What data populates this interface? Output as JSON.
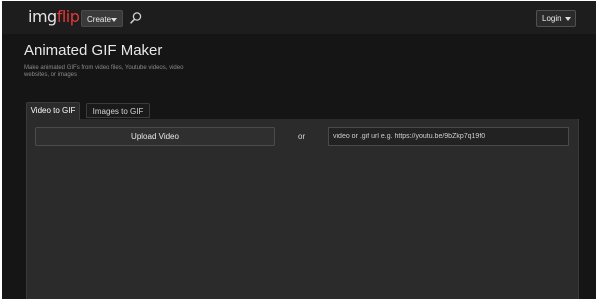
{
  "header": {
    "logo_img": "img",
    "logo_flip": "flip",
    "create_label": "Create",
    "login_label": "Login"
  },
  "main": {
    "title": "Animated GIF Maker",
    "subtitle": "Make animated GIFs from video files, Youtube videos, video websites, or images",
    "tabs": [
      {
        "label": "Video to GIF",
        "active": true
      },
      {
        "label": "Images to GIF",
        "active": false
      }
    ],
    "upload_label": "Upload Video",
    "or_label": "or",
    "url_input": {
      "value": "",
      "placeholder": "video or .gif url e.g. https://youtu.be/9bZkp7q19f0"
    }
  },
  "colors": {
    "brand_red": "#e23838",
    "background": "#151515",
    "panel": "#2b2b2b"
  },
  "icons": {
    "search": "search-icon",
    "dropdown": "caret-down-icon"
  }
}
